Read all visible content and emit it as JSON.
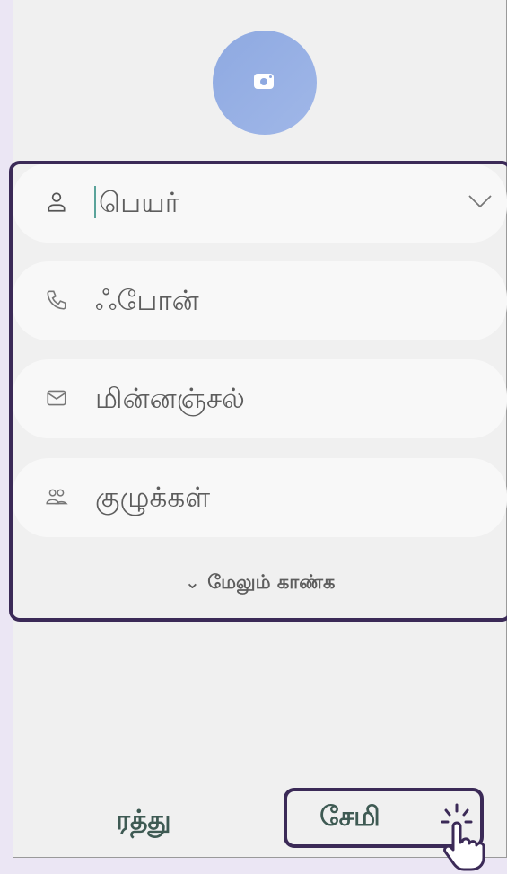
{
  "form": {
    "fields": [
      {
        "label": "பெயர்",
        "icon": "person-icon"
      },
      {
        "label": "ஃபோன்",
        "icon": "phone-icon"
      },
      {
        "label": "மின்னஞ்சல்",
        "icon": "email-icon"
      },
      {
        "label": "குழுக்கள்",
        "icon": "group-icon"
      }
    ],
    "more_label": "மேலும் காண்க"
  },
  "actions": {
    "cancel_label": "ரத்து",
    "save_label": "சேமி"
  },
  "colors": {
    "avatar": "#8ea9e1",
    "highlight": "#3b2a57",
    "button_text": "#3e5a53",
    "caret": "#5aa39a"
  }
}
